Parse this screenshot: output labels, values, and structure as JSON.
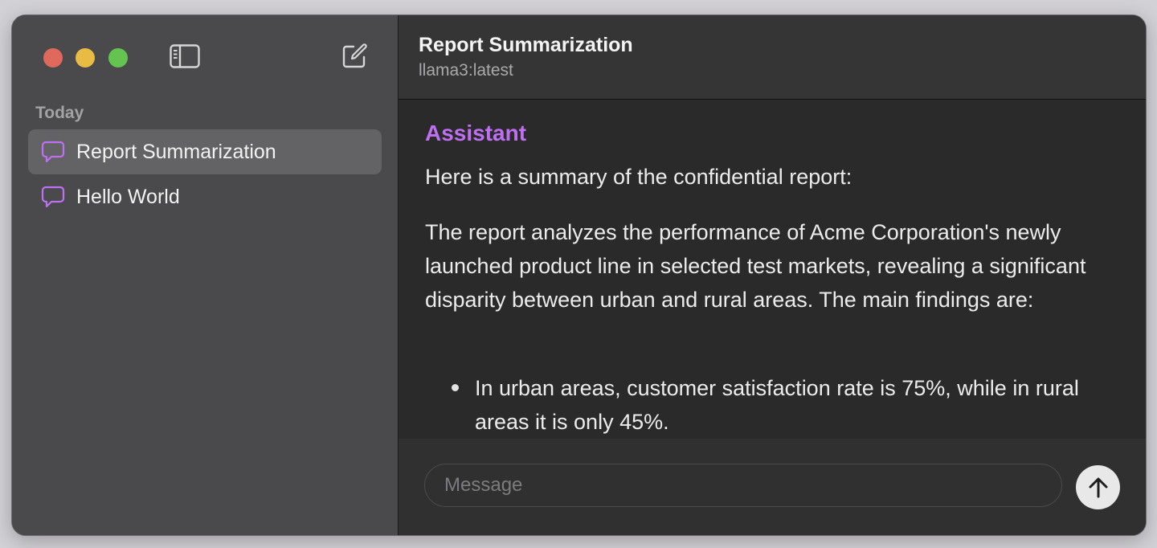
{
  "window": {
    "traffic_lights": {
      "close_color": "#e0695d",
      "minimize_color": "#e8bc44",
      "maximize_color": "#64c44f"
    }
  },
  "sidebar": {
    "toggle_icon": "sidebar-toggle-icon",
    "new_chat_icon": "compose-icon",
    "section_label": "Today",
    "items": [
      {
        "label": "Report Summarization",
        "icon": "chat-bubble-icon",
        "selected": true
      },
      {
        "label": "Hello World",
        "icon": "chat-bubble-icon",
        "selected": false
      }
    ],
    "accent_color": "#bf6ff2"
  },
  "header": {
    "title": "Report Summarization",
    "model": "llama3:latest"
  },
  "conversation": {
    "role": "Assistant",
    "paragraphs": [
      "Here is a summary of the confidential report:",
      "The report analyzes the performance of Acme Corporation's newly launched product line in selected test markets, revealing a significant disparity between urban and rural areas. The main findings are:"
    ],
    "bullets": [
      "In urban areas, customer satisfaction rate is 75%, while in rural areas it is only 45%."
    ]
  },
  "composer": {
    "placeholder": "Message",
    "value": "",
    "send_icon": "arrow-up-icon"
  }
}
